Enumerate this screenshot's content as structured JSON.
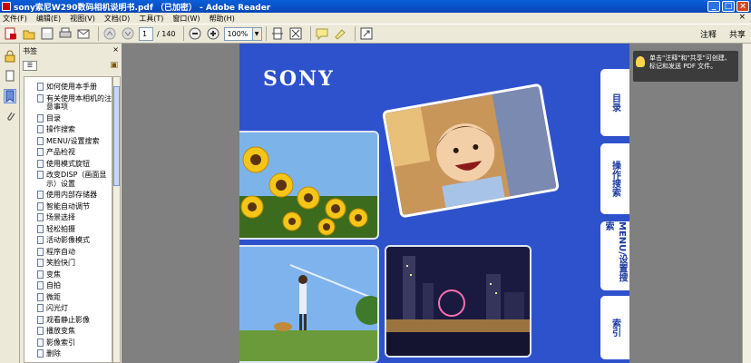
{
  "window": {
    "title": "sony索尼W290数码相机说明书.pdf （已加密） - Adobe Reader",
    "minimize": "_",
    "maximize": "□",
    "close": "×"
  },
  "menu": {
    "items": [
      "文件(F)",
      "编辑(E)",
      "视图(V)",
      "文档(D)",
      "工具(T)",
      "窗口(W)",
      "帮助(H)"
    ],
    "close": "×"
  },
  "toolbar": {
    "page_current": "1",
    "page_total": "/ 140",
    "zoom": "100%",
    "comment_label": "注释",
    "share_label": "共享"
  },
  "bookmarks": {
    "header": "书签",
    "items": [
      "如何使用本手册",
      "有关使用本相机的注意事项",
      "目录",
      "操作搜索",
      "MENU/设置搜索",
      "产品检视",
      "使用模式旋钮",
      "改变DISP（画面显示）设置",
      "使用内部存储器",
      "智能自动调节",
      "场景选择",
      "轻松拍摄",
      "活动影像模式",
      "程序自动",
      "笑脸快门",
      "变焦",
      "自拍",
      "微距",
      "闪光灯",
      "观看静止影像",
      "播放变焦",
      "影像索引",
      "删除"
    ]
  },
  "document": {
    "logo": "SONY",
    "tabs": [
      "目录",
      "操作搜索",
      "MENU/设置搜索",
      "索引"
    ]
  },
  "tooltip": {
    "text": "单击\"注释\"和\"共享\"可创建、标记和发送 PDF 文件。"
  }
}
